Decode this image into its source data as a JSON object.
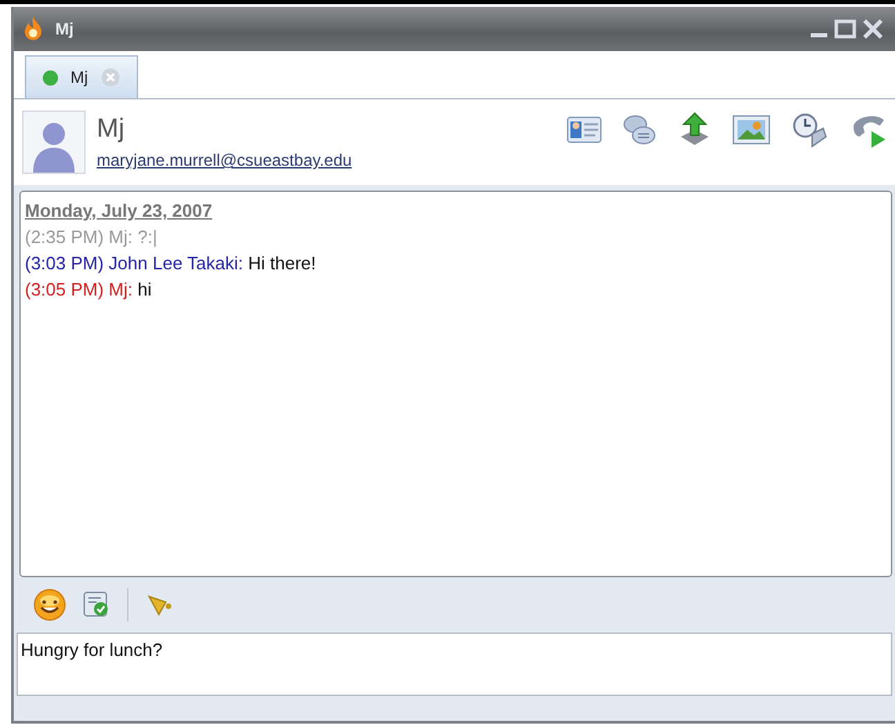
{
  "window": {
    "title": "Mj"
  },
  "tabs": [
    {
      "label": "Mj",
      "selected": true,
      "color": "#3cb043"
    }
  ],
  "contact": {
    "name": "Mj",
    "email": "maryjane.murrell@csueastbay.edu"
  },
  "transcript": {
    "date": "Monday, July 23, 2007",
    "messages": [
      {
        "kind": "history",
        "time": "(2:35 PM)",
        "sender": "Mj:",
        "text": "?:|"
      },
      {
        "kind": "remote",
        "time": "(3:03 PM)",
        "sender": "John Lee Takaki:",
        "text": "Hi there!"
      },
      {
        "kind": "local",
        "time": "(3:05 PM)",
        "sender": "Mj:",
        "text": "hi"
      }
    ]
  },
  "compose": {
    "value": "Hungry for lunch?"
  }
}
